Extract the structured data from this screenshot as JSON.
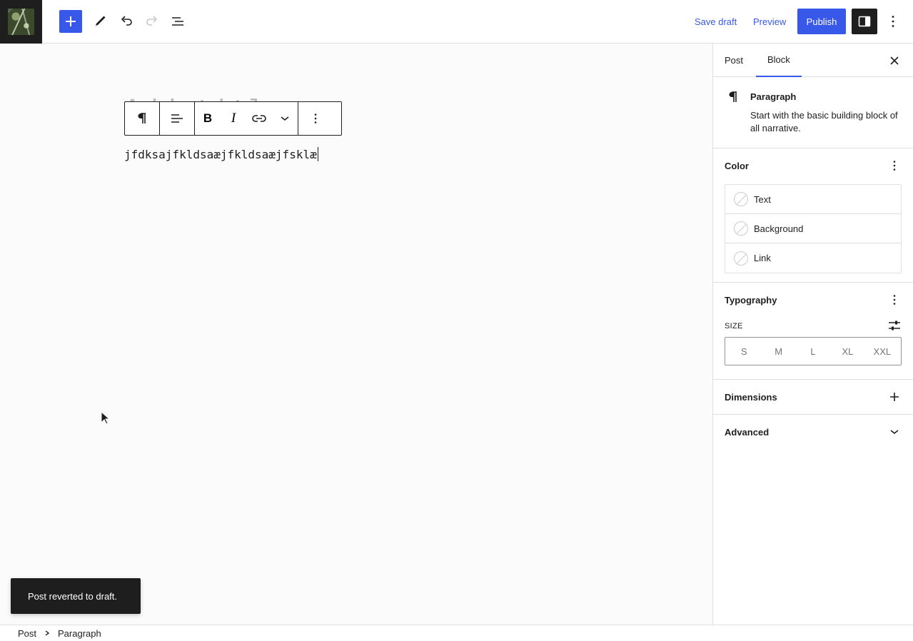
{
  "header": {
    "save_draft": "Save draft",
    "preview": "Preview",
    "publish": "Publish",
    "accent_color": "#3858e9"
  },
  "editor": {
    "ghost_title": "Add title",
    "paragraph_text": "jfdksajfkldsaæjfkldsaæjfsklæ",
    "toolbar": {
      "bold": "B",
      "italic": "I"
    }
  },
  "snackbar": {
    "message": "Post reverted to draft."
  },
  "sidebar": {
    "tabs": [
      {
        "label": "Post"
      },
      {
        "label": "Block"
      }
    ],
    "block_card": {
      "title": "Paragraph",
      "description": "Start with the basic building block of all narrative."
    },
    "color": {
      "title": "Color",
      "items": [
        {
          "label": "Text"
        },
        {
          "label": "Background"
        },
        {
          "label": "Link"
        }
      ]
    },
    "typography": {
      "title": "Typography",
      "size_label": "SIZE",
      "sizes": [
        "S",
        "M",
        "L",
        "XL",
        "XXL"
      ]
    },
    "dimensions": {
      "title": "Dimensions"
    },
    "advanced": {
      "title": "Advanced"
    }
  },
  "breadcrumb": {
    "items": [
      "Post",
      "Paragraph"
    ]
  }
}
